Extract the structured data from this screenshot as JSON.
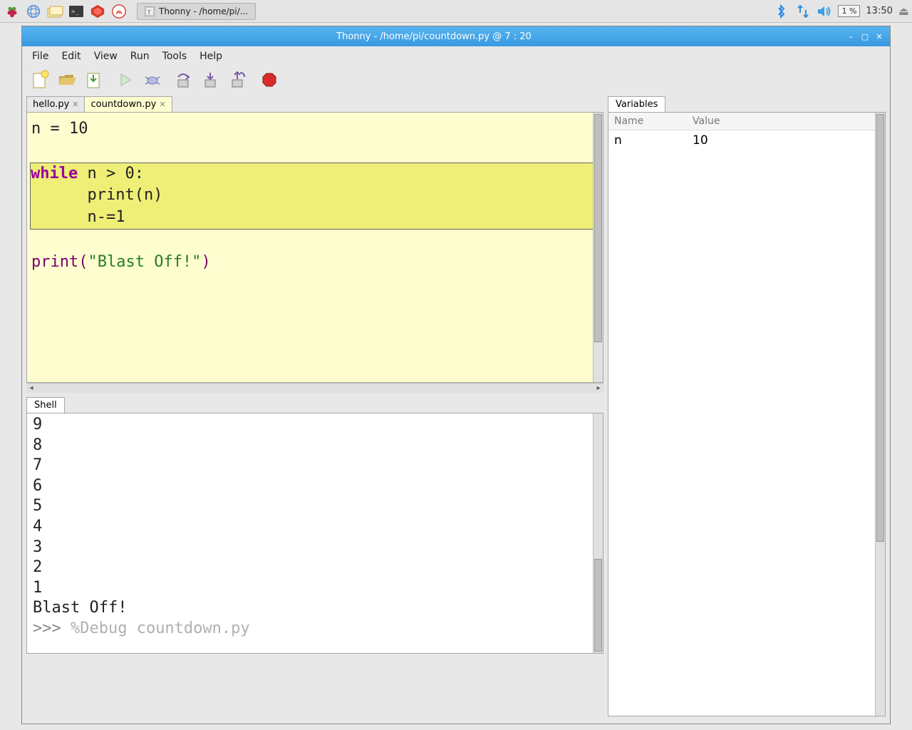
{
  "taskbar": {
    "app_label": "Thonny  -  /home/pi/...",
    "battery": "1 %",
    "clock": "13:50"
  },
  "window": {
    "title": "Thonny  -  /home/pi/countdown.py  @  7 : 20"
  },
  "menus": {
    "file": "File",
    "edit": "Edit",
    "view": "View",
    "run": "Run",
    "tools": "Tools",
    "help": "Help"
  },
  "tabs": {
    "hello": "hello.py",
    "countdown": "countdown.py"
  },
  "code": {
    "line1_a": "n ",
    "line1_b": "= ",
    "line1_c": "10",
    "block_kw": "while",
    "block_cond": " n > 0:",
    "block_l2a": "      print(n)",
    "block_l3a": "      n-=1",
    "last_a": "print(",
    "last_str": "\"Blast Off!\"",
    "last_b": ")"
  },
  "shell": {
    "tab": "Shell",
    "lines": [
      "9",
      "8",
      "7",
      "6",
      "5",
      "4",
      "3",
      "2",
      "1",
      "Blast Off!"
    ],
    "prompt": ">>> ",
    "cmd": "%Debug countdown.py"
  },
  "vars": {
    "tab": "Variables",
    "head_name": "Name",
    "head_value": "Value",
    "rows": [
      {
        "name": "n",
        "value": "10"
      }
    ]
  }
}
